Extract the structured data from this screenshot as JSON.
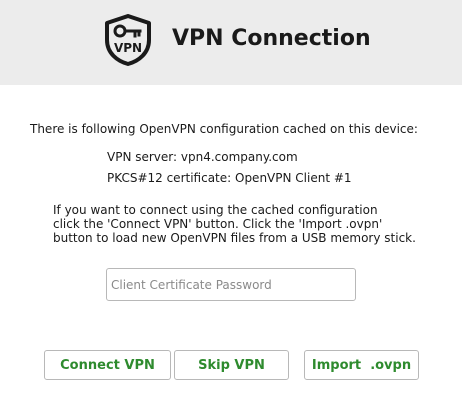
{
  "header": {
    "title": "VPN Connection",
    "logo_icon": "vpn-shield-key-icon",
    "logo_text": "VPN"
  },
  "content": {
    "intro": "There is following OpenVPN configuration cached on this device:",
    "server_line": "VPN server: vpn4.company.com",
    "cert_line": "PKCS#12 certificate: OpenVPN Client #1",
    "explain_lines": [
      "If you want to connect using the cached configuration",
      "click the 'Connect VPN' button. Click the 'Import .ovpn'",
      "button to load new OpenVPN files from a USB memory stick."
    ]
  },
  "password": {
    "value": "",
    "placeholder": "Client Certificate Password"
  },
  "buttons": {
    "connect": "Connect VPN",
    "skip": "Skip VPN",
    "import": "Import  .ovpn"
  },
  "colors": {
    "header_bg": "#ececec",
    "button_text": "#2e8b2e",
    "border": "#b8b8b8"
  }
}
